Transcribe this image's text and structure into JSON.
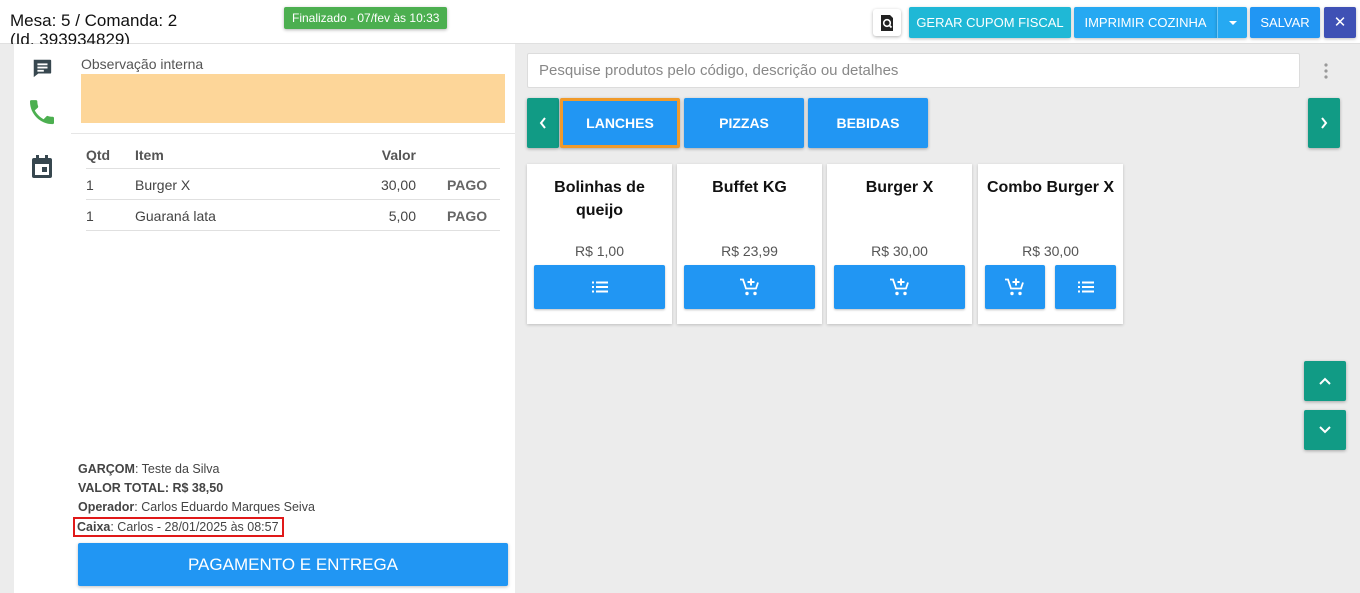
{
  "header": {
    "title_line1": "Mesa: 5 / Comanda: 2",
    "title_line2": "(Id. 393934829)",
    "status_badge": "Finalizado - 07/fev às 10:33",
    "buttons": {
      "search_icon": "receipt-search-icon",
      "gerar_cupom": "GERAR CUPOM FISCAL",
      "imprimir_cozinha": "IMPRIMIR COZINHA",
      "salvar": "SALVAR",
      "close": "✕"
    }
  },
  "rail": {
    "icons": [
      "chat-icon",
      "phone-icon",
      "calendar-icon"
    ]
  },
  "order": {
    "observacao_label": "Observação interna",
    "table": {
      "headers": {
        "qtd": "Qtd",
        "item": "Item",
        "valor": "Valor"
      },
      "rows": [
        {
          "qtd": "1",
          "item": "Burger X",
          "valor": "30,00",
          "status": "PAGO"
        },
        {
          "qtd": "1",
          "item": "Guaraná lata",
          "valor": "5,00",
          "status": "PAGO"
        }
      ]
    },
    "summary": {
      "garcom_label": "GARÇOM",
      "garcom_value": ": Teste da Silva",
      "valor_total_label": "VALOR TOTAL",
      "valor_total_value": ": R$ 38,50",
      "operador_label": "Operador",
      "operador_value": ": Carlos Eduardo Marques Seiva",
      "caixa_label": "Caixa",
      "caixa_value": ": Carlos - 28/01/2025 às 08:57"
    },
    "pay_button": "PAGAMENTO E ENTREGA"
  },
  "products": {
    "search_placeholder": "Pesquise produtos pelo código, descrição ou detalhes",
    "search_value": "",
    "categories": [
      {
        "label": "LANCHES",
        "active": true
      },
      {
        "label": "PIZZAS",
        "active": false
      },
      {
        "label": "BEBIDAS",
        "active": false
      }
    ],
    "items": [
      {
        "name": "Bolinhas de queijo",
        "price": "R$ 1,00",
        "actions": [
          "list-icon"
        ]
      },
      {
        "name": "Buffet KG",
        "price": "R$ 23,99",
        "actions": [
          "add-cart-icon"
        ]
      },
      {
        "name": "Burger X",
        "price": "R$ 30,00",
        "actions": [
          "add-cart-icon"
        ]
      },
      {
        "name": "Combo Burger X",
        "price": "R$ 30,00",
        "actions": [
          "add-cart-icon",
          "list-icon"
        ]
      }
    ]
  },
  "colors": {
    "primary_blue": "#2196f3",
    "teal": "#119b85",
    "cyan": "#1fb8d6",
    "indigo": "#3f51b5",
    "status_green": "#4caf50",
    "observation_bg": "#fdd699",
    "active_category_border": "#f09a2a",
    "highlight_red": "#e01919"
  }
}
